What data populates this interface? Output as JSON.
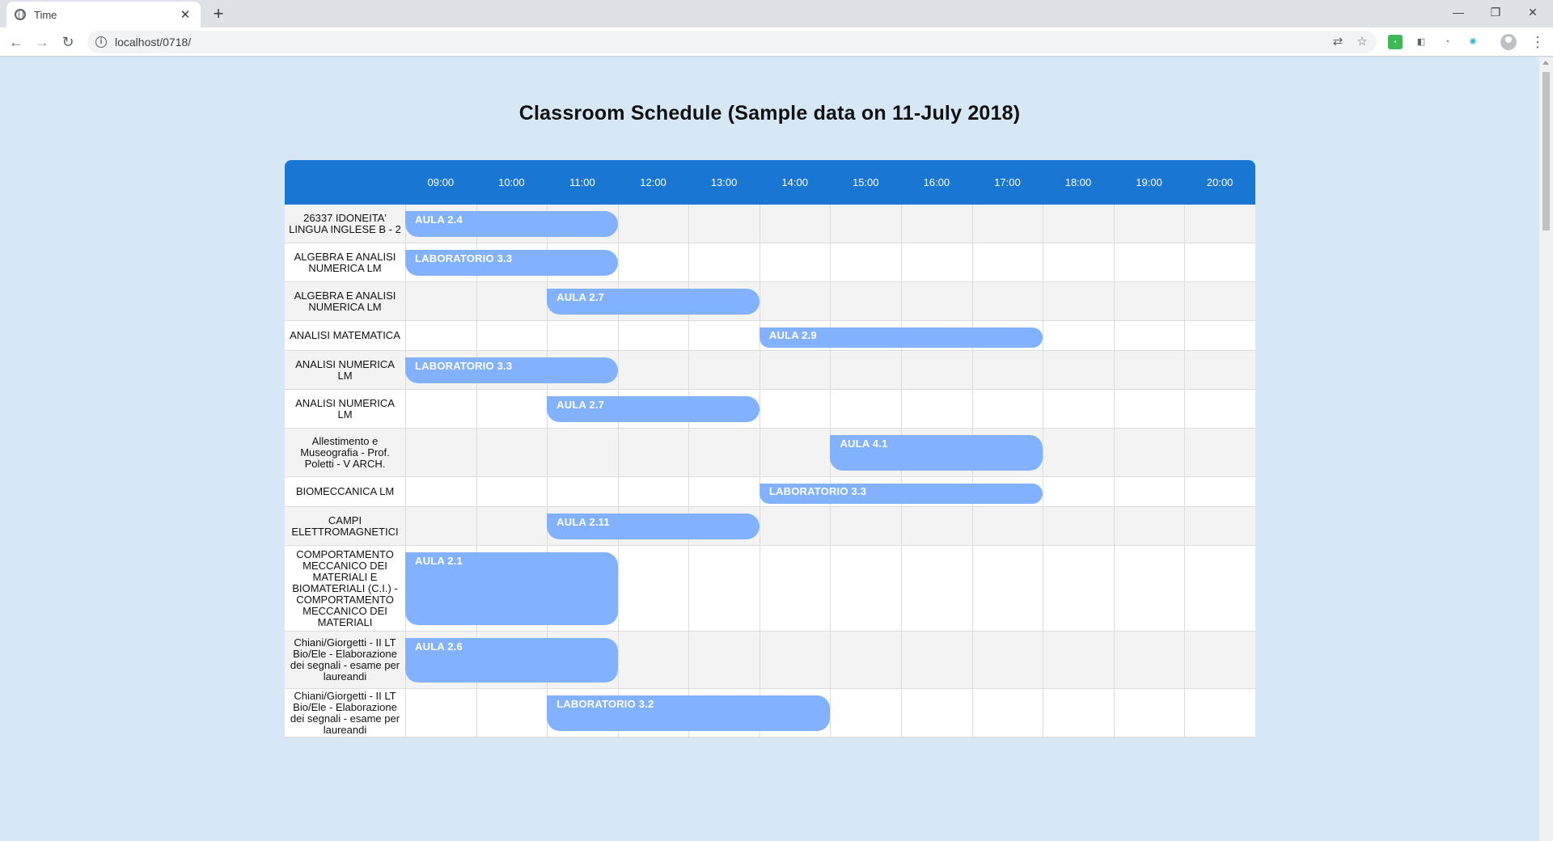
{
  "browser": {
    "tab_title": "Time",
    "url": "localhost/0718/"
  },
  "page": {
    "title": "Classroom Schedule (Sample data on 11-July 2018)"
  },
  "schedule": {
    "hours": [
      "09:00",
      "10:00",
      "11:00",
      "12:00",
      "13:00",
      "14:00",
      "15:00",
      "16:00",
      "17:00",
      "18:00",
      "19:00",
      "20:00"
    ],
    "rows": [
      {
        "course": "26337 IDONEITA' LINGUA INGLESE B - 2",
        "room": "AULA 2.4",
        "start": "09:00",
        "end": "12:00"
      },
      {
        "course": "ALGEBRA E ANALISI NUMERICA LM",
        "room": "LABORATORIO 3.3",
        "start": "09:00",
        "end": "12:00"
      },
      {
        "course": "ALGEBRA E ANALISI NUMERICA LM",
        "room": "AULA 2.7",
        "start": "11:00",
        "end": "14:00"
      },
      {
        "course": "ANALISI MATEMATICA",
        "room": "AULA 2.9",
        "start": "14:00",
        "end": "18:00"
      },
      {
        "course": "ANALISI NUMERICA LM",
        "room": "LABORATORIO 3.3",
        "start": "09:00",
        "end": "12:00"
      },
      {
        "course": "ANALISI NUMERICA LM",
        "room": "AULA 2.7",
        "start": "11:00",
        "end": "14:00"
      },
      {
        "course": "Allestimento e Museografia - Prof. Poletti - V ARCH.",
        "room": "AULA 4.1",
        "start": "15:00",
        "end": "18:00"
      },
      {
        "course": "BIOMECCANICA LM",
        "room": "LABORATORIO 3.3",
        "start": "14:00",
        "end": "18:00"
      },
      {
        "course": "CAMPI ELETTROMAGNETICI",
        "room": "AULA 2.11",
        "start": "11:00",
        "end": "14:00"
      },
      {
        "course": "COMPORTAMENTO MECCANICO DEI MATERIALI E BIOMATERIALI (C.I.) - COMPORTAMENTO MECCANICO DEI MATERIALI",
        "room": "AULA 2.1",
        "start": "09:00",
        "end": "12:00"
      },
      {
        "course": "Chiani/Giorgetti - II LT Bio/Ele - Elaborazione dei segnali - esame per laureandi",
        "room": "AULA 2.6",
        "start": "09:00",
        "end": "12:00"
      },
      {
        "course": "Chiani/Giorgetti - II LT Bio/Ele - Elaborazione dei segnali - esame per laureandi",
        "room": "LABORATORIO 3.2",
        "start": "11:00",
        "end": "15:00"
      }
    ]
  }
}
